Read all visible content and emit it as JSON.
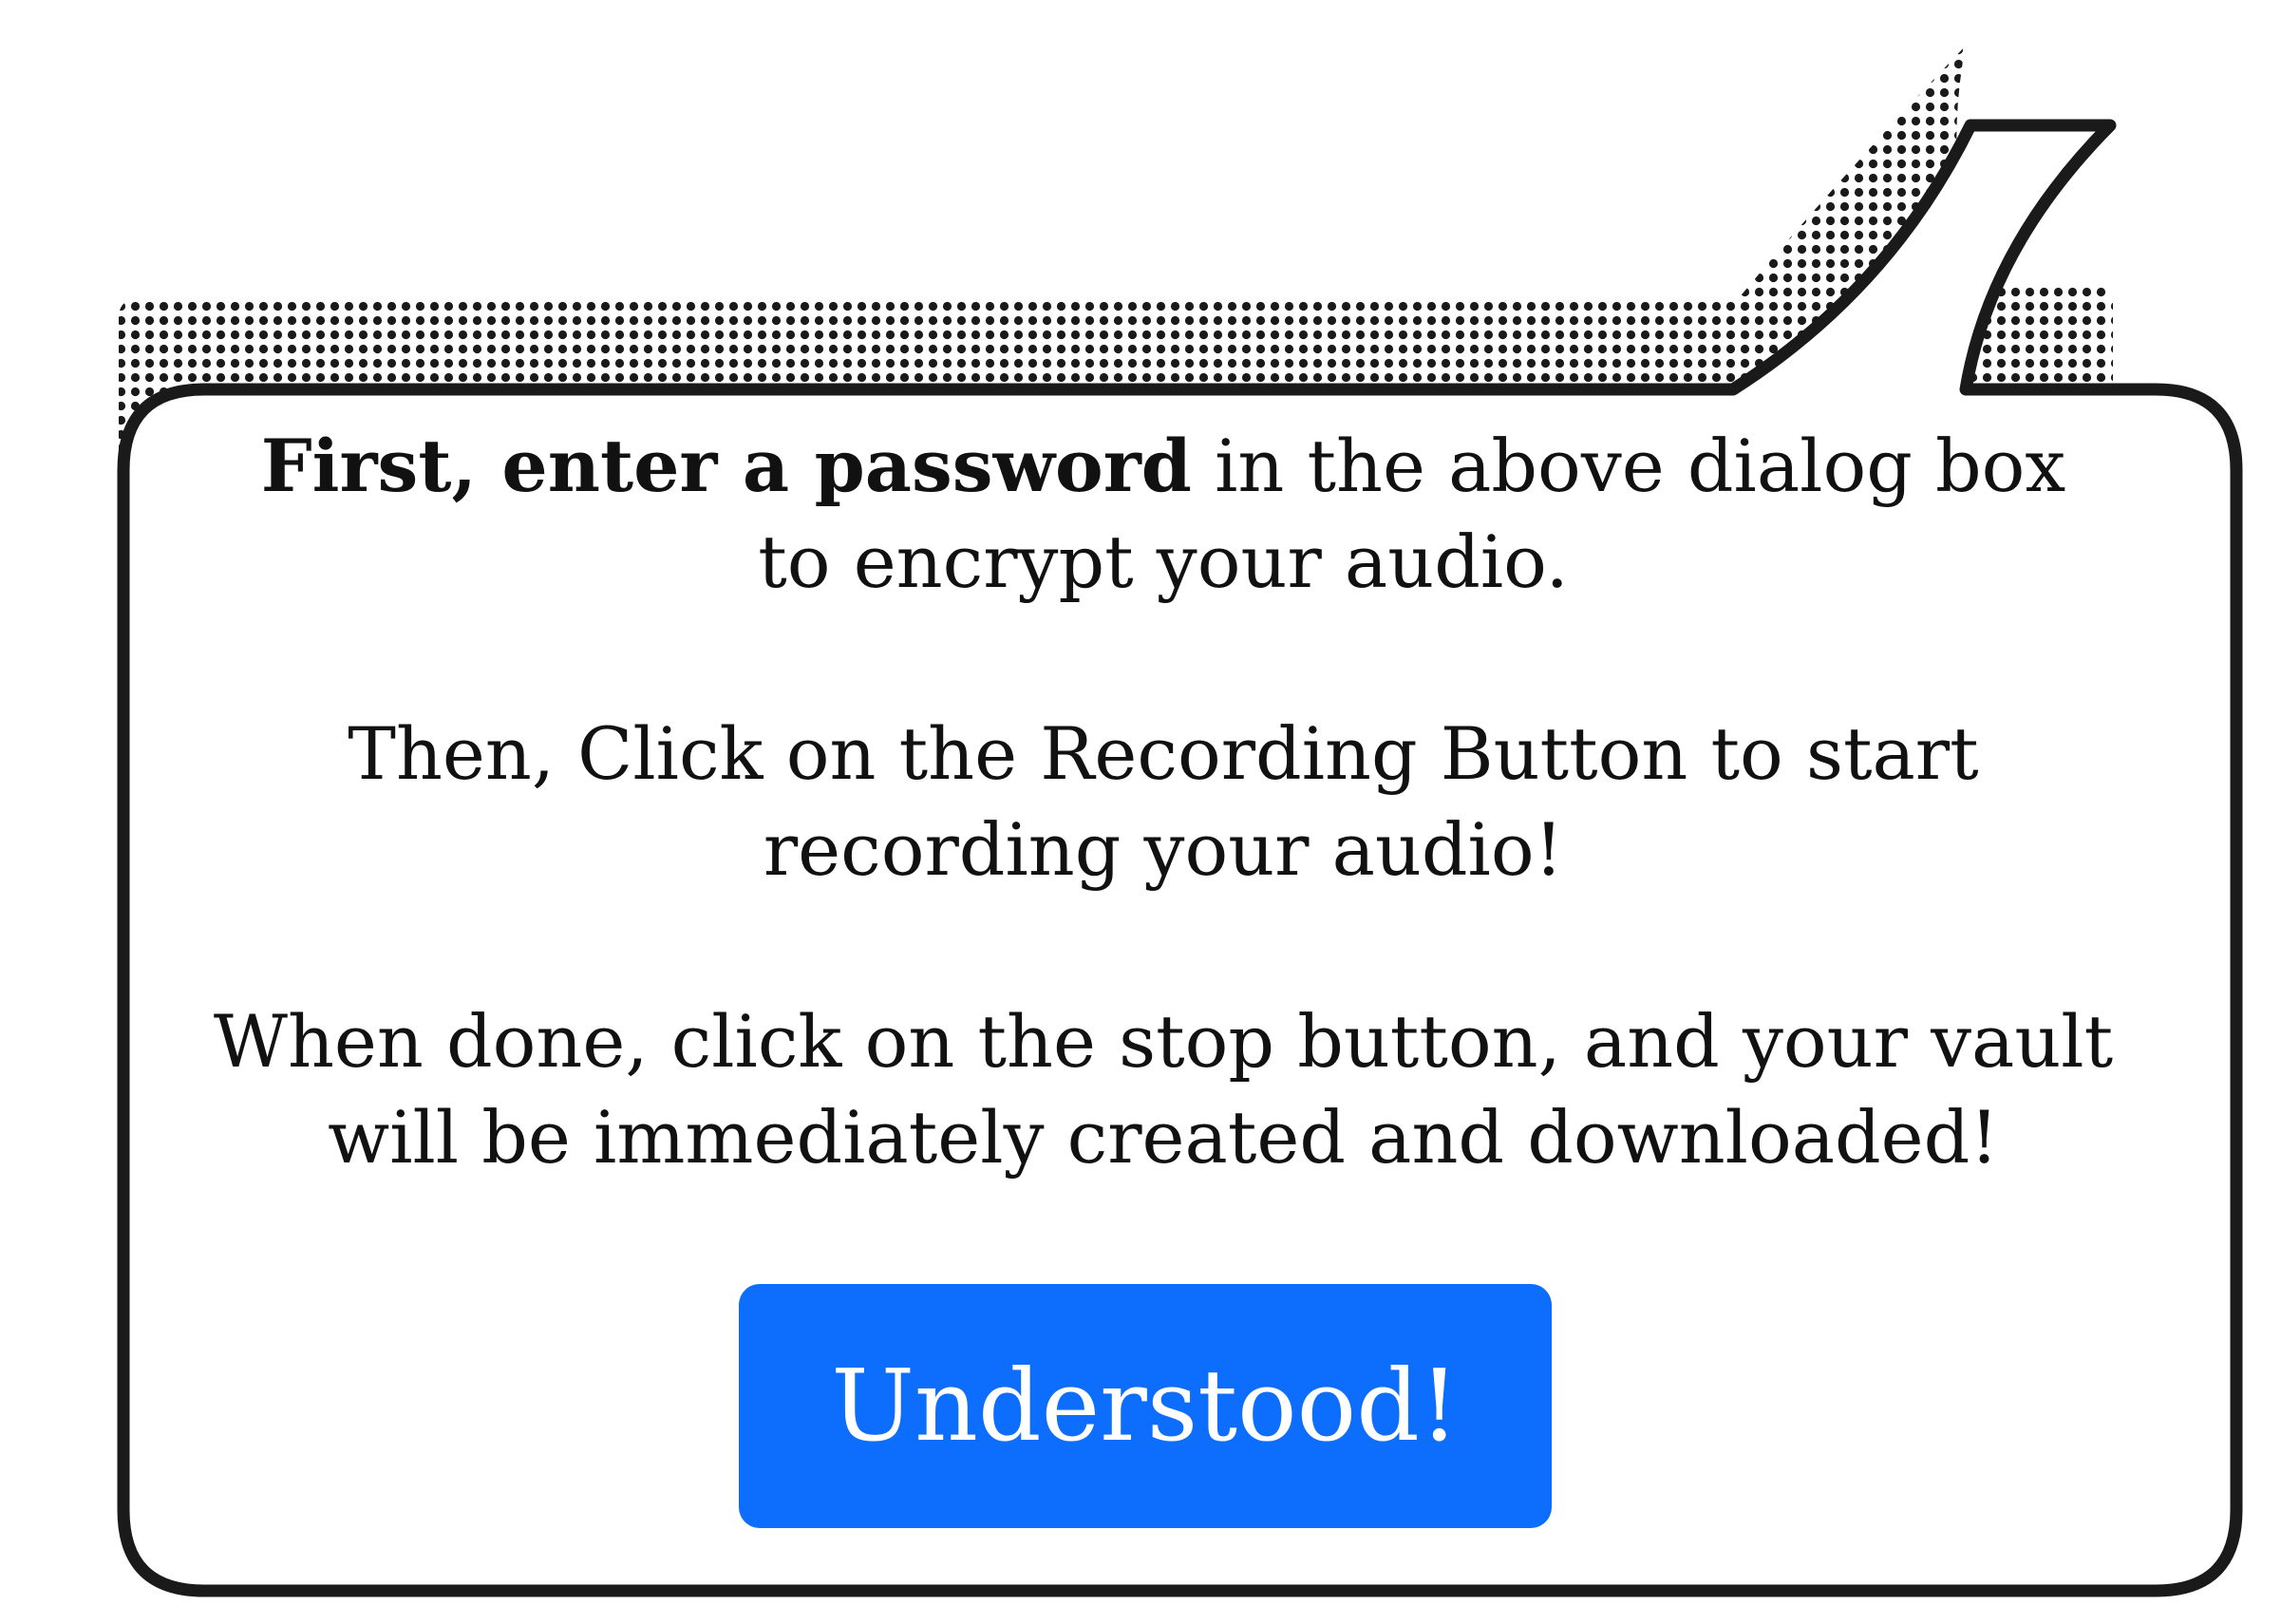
{
  "dialog": {
    "intro_bold": "First, enter a password",
    "intro_rest": " in the above dialog box\nto encrypt your audio.",
    "step_two": "Then, Click on the Recording Button to start\nrecording your audio!",
    "step_three": "When done, click on the stop button, and your vault\nwill be immediately created and downloaded!",
    "button_label": "Understood!"
  },
  "colors": {
    "button_background": "#0d6efd",
    "button_text": "#ffffff",
    "bubble_outline": "#1a1a1a",
    "halftone_dots": "#1a1a1a",
    "text": "#111111"
  }
}
